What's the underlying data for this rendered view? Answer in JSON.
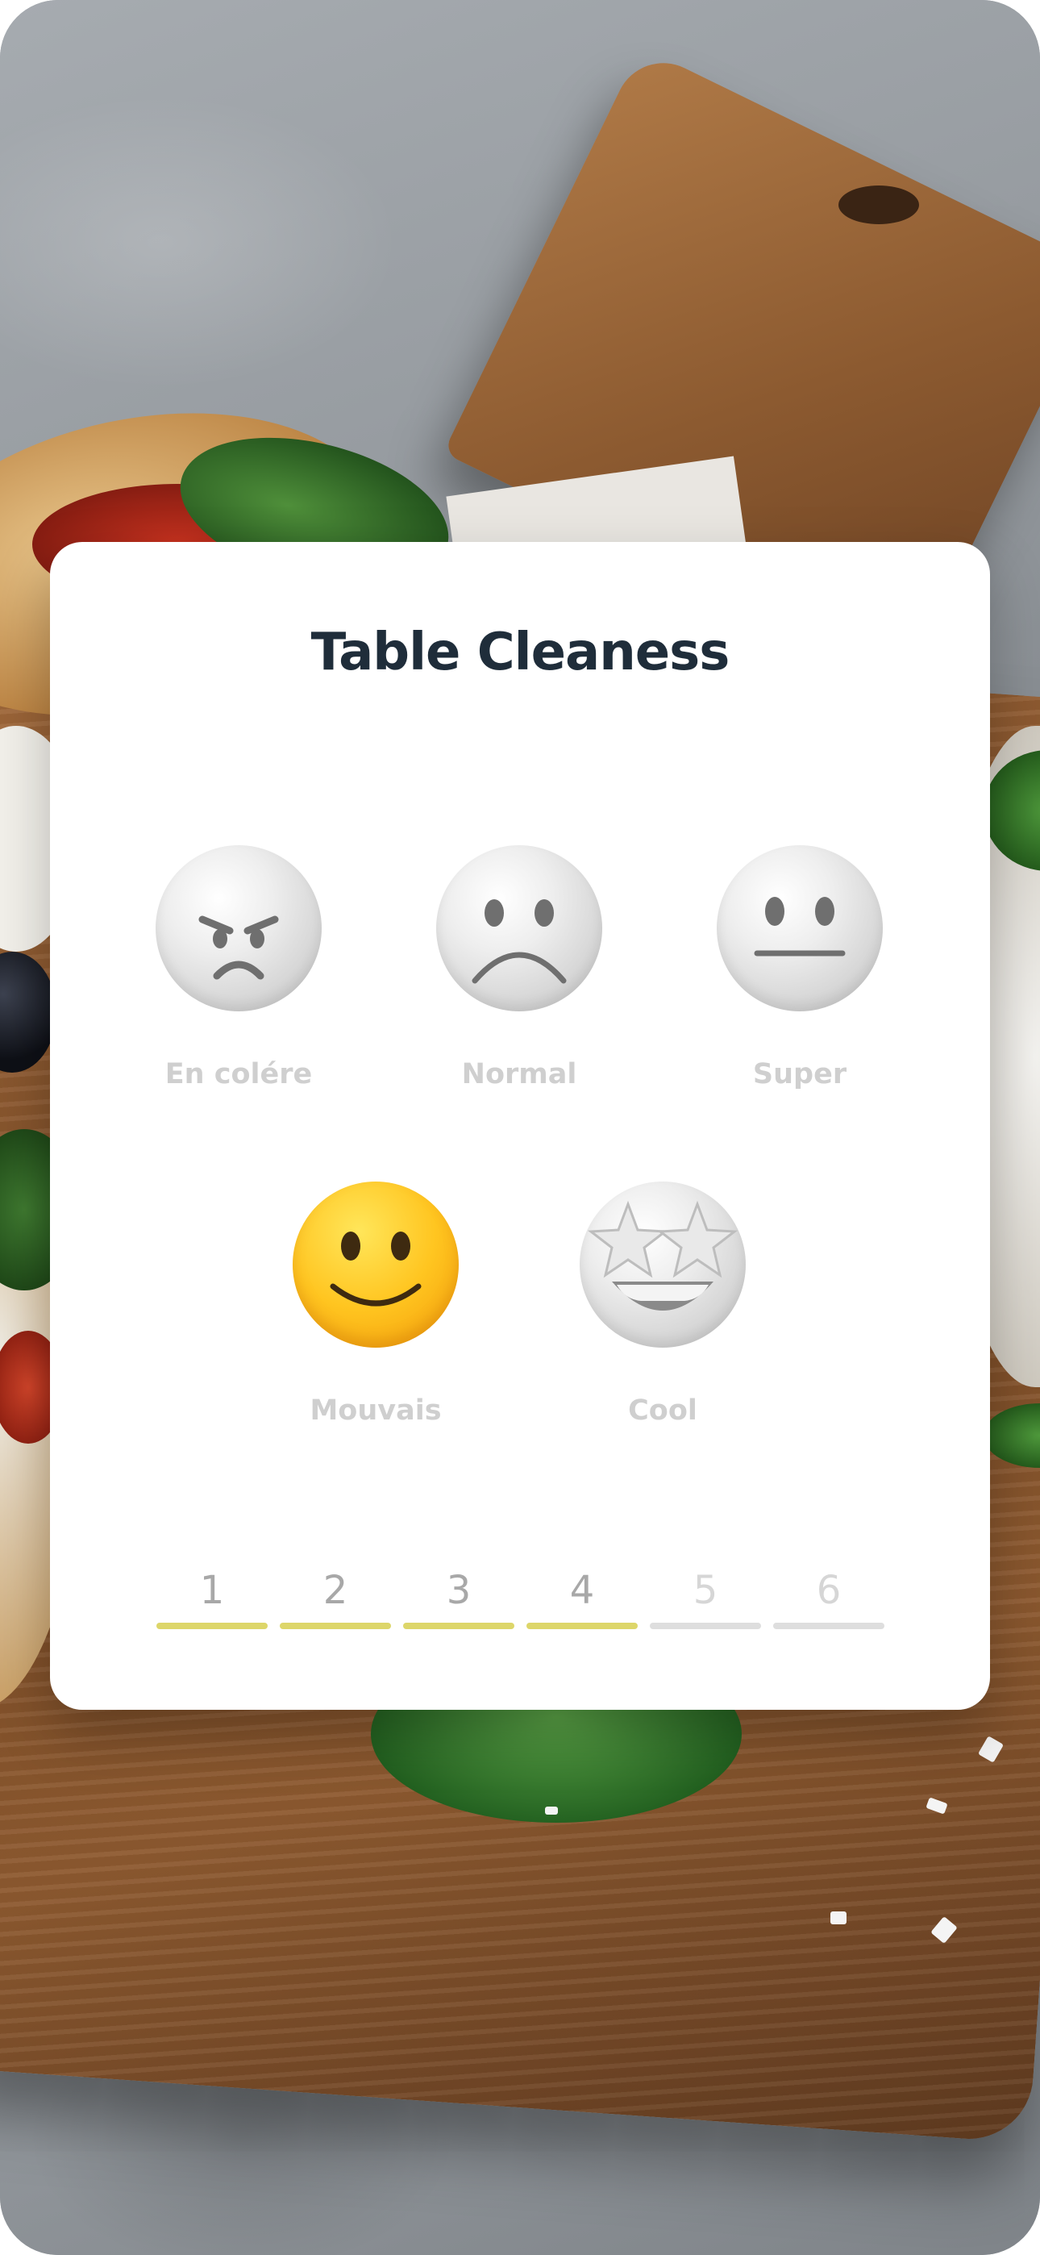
{
  "card": {
    "title": "Table Cleaness"
  },
  "options": [
    {
      "label": "En colére",
      "icon": "angry-face-icon"
    },
    {
      "label": "Normal",
      "icon": "frowning-face-icon"
    },
    {
      "label": "Super",
      "icon": "neutral-face-icon"
    },
    {
      "label": "Mouvais",
      "icon": "slightly-smiling-face-icon",
      "selected": true
    },
    {
      "label": "Cool",
      "icon": "star-struck-face-icon"
    }
  ],
  "progress": {
    "steps": [
      "1",
      "2",
      "3",
      "4",
      "5",
      "6"
    ],
    "current": 4,
    "active_color": "#ddd66a",
    "inactive_color": "#dedede"
  }
}
